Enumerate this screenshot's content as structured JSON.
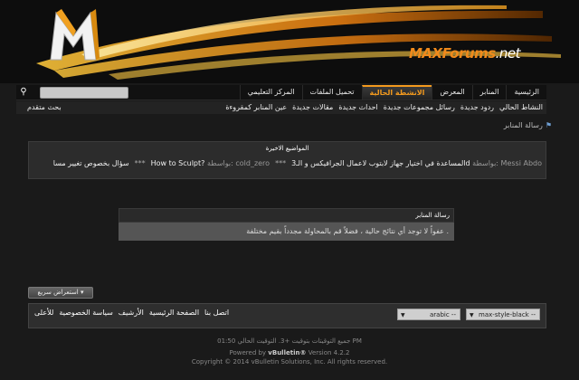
{
  "brand": {
    "name": "MAXForums",
    "tld": ".net"
  },
  "nav": {
    "tabs": [
      "الرئيسية",
      "المنابر",
      "المعرض",
      "الانشطة الحالية",
      "تحميل الملفات",
      "المركز التعليمي"
    ],
    "active_tab": 3
  },
  "subnav": {
    "links": [
      "النشاط الحالي",
      "ردود جديدة",
      "رسائل مجموعات جديدة",
      "احداث جديدة",
      "مقالات جديدة",
      "عين المنابر كمقروءة"
    ],
    "advanced_search": "بحث متقدم"
  },
  "breadcrumb": {
    "label": "رسالة المنابر"
  },
  "latest": {
    "title": "المواضيع الاخيرة",
    "items": [
      {
        "title": "المساعدة في اختيار جهاز لابتوب لاعمال الجرافيكس و الـ3d",
        "by_label": "بواسطة:",
        "author": "Messi Abdo"
      },
      {
        "title": "How to Sculpt?",
        "by_label": "بواسطة:",
        "author": "cold_zero"
      },
      {
        "title": "سؤال بخصوص تغيير مسا",
        "by_label": "",
        "author": ""
      }
    ],
    "sep": "***"
  },
  "message": {
    "title": "رسالة المنابر",
    "body": "عفواً لا توجد أي نتائج حالية ، فضلاً قم بالمحاولة مجدداً بقيم مختلفة ."
  },
  "quick_button": "استعراض سريع",
  "footer": {
    "style_select": "max-style-black --",
    "lang_select": "arabic --",
    "links": [
      "اتصل بنا",
      "الصفحة الرئيسية",
      "الأرشيف",
      "سياسة الخصوصية",
      "للأعلى"
    ]
  },
  "copyright": {
    "line1": "جميع التوقيتات بتوقيت +3. التوقيت الحالي 01:50 PM",
    "line2_a": "Powered by ",
    "line2_b": "vBulletin®",
    "line2_c": " Version 4.2.2",
    "line3": "Copyright © 2014 vBulletin Solutions, Inc. All rights reserved."
  },
  "colors": {
    "accent": "#f39a1e",
    "bg": "#1a1a1a"
  }
}
